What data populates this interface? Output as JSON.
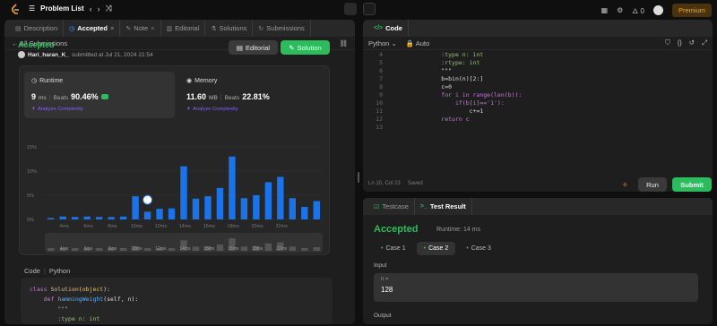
{
  "topbar": {
    "title": "Problem List",
    "coins": "0",
    "premium": "Premium"
  },
  "left_panel": {
    "tabs": [
      {
        "label": "Description",
        "icon": "document-icon",
        "active": false
      },
      {
        "label": "Accepted",
        "icon": "clock-icon",
        "active": true
      },
      {
        "label": "Note",
        "icon": "note-icon",
        "active": false
      },
      {
        "label": "Editorial",
        "icon": "book-icon",
        "active": false
      },
      {
        "label": "Solutions",
        "icon": "flask-icon",
        "active": false
      },
      {
        "label": "Submissions",
        "icon": "history-icon",
        "active": false
      }
    ],
    "back_label": "All Submissions",
    "status": "Accepted",
    "user": "Hari_haran_K_",
    "submitted": "submitted at Jul 21, 2024 21:54",
    "editorial_btn": "Editorial",
    "solution_btn": "Solution",
    "runtime": {
      "title": "Runtime",
      "value": "9",
      "unit": "ms",
      "beats_label": "Beats",
      "beats": "90.46%",
      "analyze": "Analyze Complexity"
    },
    "memory": {
      "title": "Memory",
      "value": "11.60",
      "unit": "MB",
      "beats_label": "Beats",
      "beats": "22.81%",
      "analyze": "Analyze Complexity"
    },
    "code_label": "Code",
    "code_lang": "Python",
    "code_lines": [
      "class Solution(object):",
      "    def hammingWeight(self, n):",
      "        \"\"\"",
      "        :type n: int"
    ]
  },
  "chart_data": {
    "type": "bar",
    "yticks": [
      "15%",
      "10%",
      "5%",
      "0%"
    ],
    "ylim": [
      0,
      15
    ],
    "xticks": [
      "4ms",
      "6ms",
      "8ms",
      "10ms",
      "12ms",
      "14ms",
      "16ms",
      "18ms",
      "20ms",
      "22ms"
    ],
    "values": [
      0.3,
      0.6,
      0.5,
      0.6,
      0.5,
      0.5,
      0.6,
      4.8,
      1.6,
      2.2,
      2.3,
      11.0,
      4.3,
      4.8,
      6.5,
      13.0,
      4.4,
      5.0,
      7.7,
      8.8,
      4.4,
      2.6,
      3.8
    ],
    "highlight_index": 9,
    "range_labels": [
      "4ms",
      "6ms",
      "8ms",
      "10ms",
      "12ms",
      "14ms",
      "16ms",
      "18ms",
      "20ms",
      "22ms"
    ]
  },
  "editor": {
    "title": "Code",
    "language": "Python",
    "mode": "Auto",
    "lines": [
      {
        "n": "4",
        "text": "        :type n: int"
      },
      {
        "n": "5",
        "text": "        :rtype: int"
      },
      {
        "n": "6",
        "text": "        \"\"\""
      },
      {
        "n": "7",
        "text": "        b=bin(n)[2:]"
      },
      {
        "n": "8",
        "text": "        c=0"
      },
      {
        "n": "9",
        "text": "        for i in range(len(b)):"
      },
      {
        "n": "10",
        "text": "            if(b[i]=='1'):"
      },
      {
        "n": "11",
        "text": "                c+=1"
      },
      {
        "n": "12",
        "text": "        return c"
      },
      {
        "n": "13",
        "text": ""
      }
    ],
    "cursor": "Ln 10, Col 23",
    "saved": "Saved",
    "run_btn": "Run",
    "submit_btn": "Submit"
  },
  "result_panel": {
    "tab_testcase": "Testcase",
    "tab_result": "Test Result",
    "status": "Accepted",
    "runtime": "Runtime: 14 ms",
    "cases": [
      "Case 1",
      "Case 2",
      "Case 3"
    ],
    "active_case": 1,
    "input_label": "Input",
    "input_var": "n =",
    "input_value": "128",
    "output_label": "Output"
  },
  "colors": {
    "accent": "#2cbb5d",
    "brand": "#ffa116",
    "bar": "#1a73e8",
    "purple": "#8f5bff"
  }
}
